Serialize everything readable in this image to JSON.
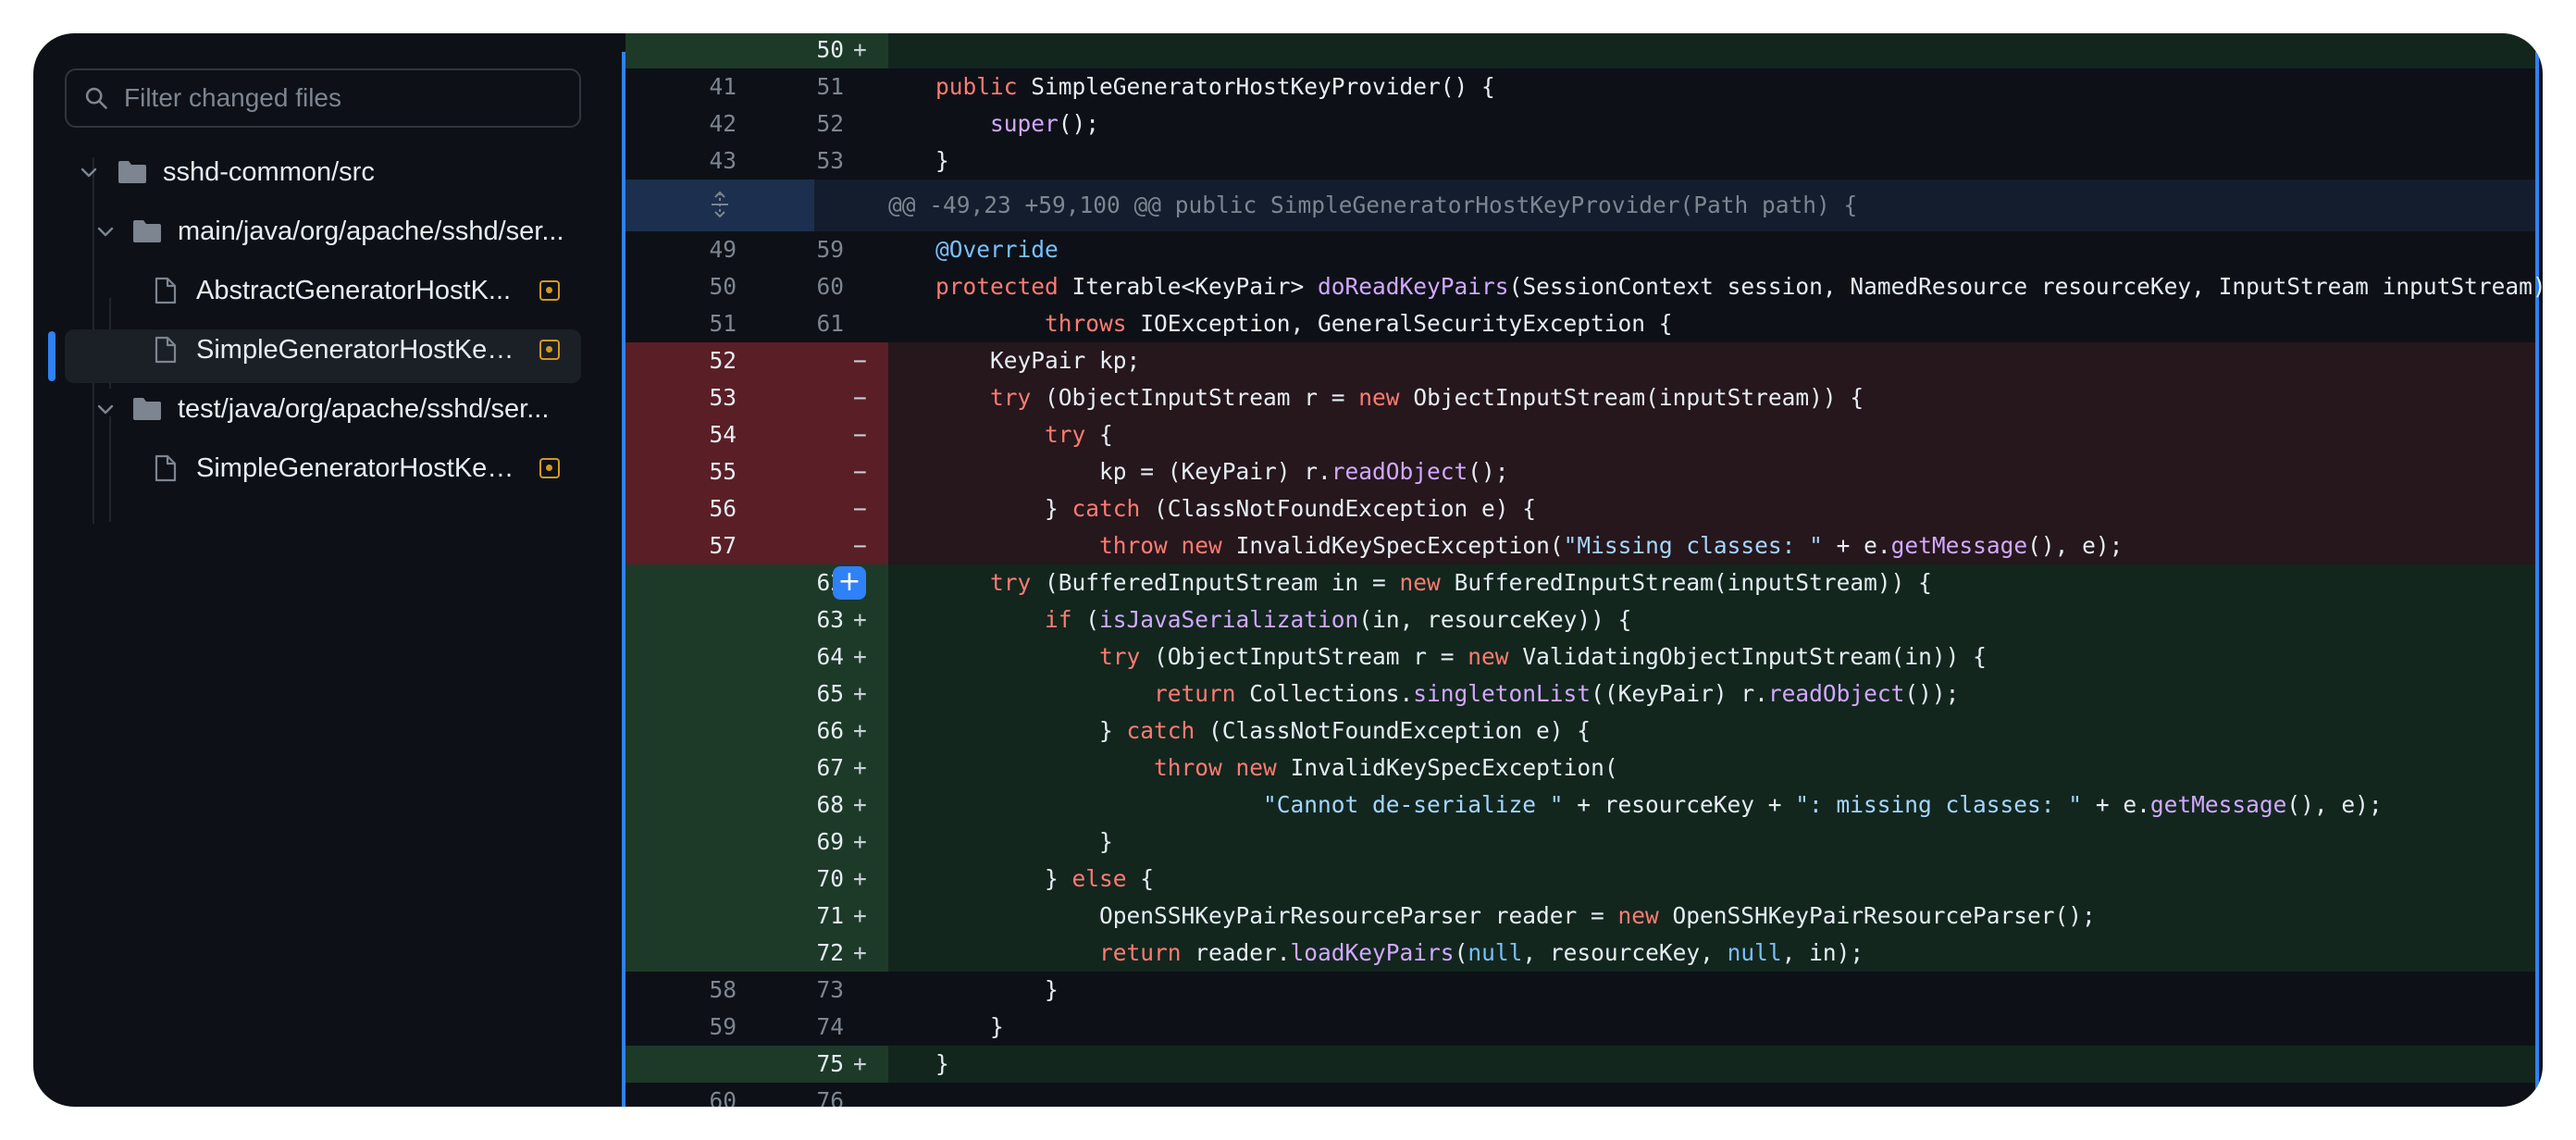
{
  "sidebar": {
    "search": {
      "placeholder": "Filter changed files"
    },
    "tree": [
      {
        "label": "sshd-common/src",
        "type": "folder"
      },
      {
        "label": "main/java/org/apache/sshd/ser...",
        "type": "folder"
      },
      {
        "label": "AbstractGeneratorHostK...",
        "type": "file",
        "status": "modified"
      },
      {
        "label": "SimpleGeneratorHostKey...",
        "type": "file",
        "status": "modified",
        "selected": true
      },
      {
        "label": "test/java/org/apache/sshd/ser...",
        "type": "folder"
      },
      {
        "label": "SimpleGeneratorHostKey...",
        "type": "file",
        "status": "modified"
      }
    ]
  },
  "diff": {
    "hunk_header": "@@ -49,23 +59,100 @@ public SimpleGeneratorHostKeyProvider(Path path) {",
    "lines": [
      {
        "type": "add",
        "old": "",
        "new": "50",
        "sign": "+",
        "code": []
      },
      {
        "type": "ctx",
        "old": "41",
        "new": "51",
        "sign": "",
        "code": [
          [
            "    ",
            ""
          ],
          [
            "public",
            "k"
          ],
          [
            " SimpleGeneratorHostKeyProvider() {",
            ""
          ]
        ]
      },
      {
        "type": "ctx",
        "old": "42",
        "new": "52",
        "sign": "",
        "code": [
          [
            "        ",
            ""
          ],
          [
            "super",
            "f"
          ],
          [
            "();",
            ""
          ]
        ]
      },
      {
        "type": "ctx",
        "old": "43",
        "new": "53",
        "sign": "",
        "code": [
          [
            "    }",
            ""
          ]
        ]
      },
      {
        "type": "hunk"
      },
      {
        "type": "ctx",
        "old": "49",
        "new": "59",
        "sign": "",
        "code": [
          [
            "    ",
            ""
          ],
          [
            "@Override",
            "c"
          ]
        ]
      },
      {
        "type": "ctx",
        "old": "50",
        "new": "60",
        "sign": "",
        "code": [
          [
            "    ",
            ""
          ],
          [
            "protected",
            "k"
          ],
          [
            " Iterable<KeyPair> ",
            ""
          ],
          [
            "doReadKeyPairs",
            "f"
          ],
          [
            "(SessionContext session, NamedResource resourceKey, InputStream inputStream)",
            ""
          ]
        ]
      },
      {
        "type": "ctx",
        "old": "51",
        "new": "61",
        "sign": "",
        "code": [
          [
            "            ",
            ""
          ],
          [
            "throws",
            "k"
          ],
          [
            " IOException, GeneralSecurityException {",
            ""
          ]
        ]
      },
      {
        "type": "del",
        "old": "52",
        "new": "",
        "sign": "−",
        "code": [
          [
            "        KeyPair kp;",
            ""
          ]
        ]
      },
      {
        "type": "del",
        "old": "53",
        "new": "",
        "sign": "−",
        "code": [
          [
            "        ",
            ""
          ],
          [
            "try",
            "k"
          ],
          [
            " (ObjectInputStream r = ",
            ""
          ],
          [
            "new",
            "k"
          ],
          [
            " ObjectInputStream(inputStream)) {",
            ""
          ]
        ]
      },
      {
        "type": "del",
        "old": "54",
        "new": "",
        "sign": "−",
        "code": [
          [
            "            ",
            ""
          ],
          [
            "try",
            "k"
          ],
          [
            " {",
            ""
          ]
        ]
      },
      {
        "type": "del",
        "old": "55",
        "new": "",
        "sign": "−",
        "code": [
          [
            "                kp = (KeyPair) r.",
            ""
          ],
          [
            "readObject",
            "f"
          ],
          [
            "();",
            ""
          ]
        ]
      },
      {
        "type": "del",
        "old": "56",
        "new": "",
        "sign": "−",
        "code": [
          [
            "            } ",
            ""
          ],
          [
            "catch",
            "k"
          ],
          [
            " (ClassNotFoundException e) {",
            ""
          ]
        ]
      },
      {
        "type": "del",
        "old": "57",
        "new": "",
        "sign": "−",
        "code": [
          [
            "                ",
            ""
          ],
          [
            "throw",
            "k"
          ],
          [
            " ",
            ""
          ],
          [
            "new",
            "k"
          ],
          [
            " InvalidKeySpecException(",
            ""
          ],
          [
            "\"Missing classes: \"",
            "s"
          ],
          [
            " + e.",
            ""
          ],
          [
            "getMessage",
            "f"
          ],
          [
            "(), e);",
            ""
          ]
        ]
      },
      {
        "type": "add",
        "old": "",
        "new": "62",
        "sign": "+",
        "plus_button": true,
        "code": [
          [
            "        ",
            ""
          ],
          [
            "try",
            "k"
          ],
          [
            " (BufferedInputStream in = ",
            ""
          ],
          [
            "new",
            "k"
          ],
          [
            " BufferedInputStream(inputStream)) {",
            ""
          ]
        ]
      },
      {
        "type": "add",
        "old": "",
        "new": "63",
        "sign": "+",
        "code": [
          [
            "            ",
            ""
          ],
          [
            "if",
            "k"
          ],
          [
            " (",
            ""
          ],
          [
            "isJavaSerialization",
            "f"
          ],
          [
            "(in, resourceKey)) {",
            ""
          ]
        ]
      },
      {
        "type": "add",
        "old": "",
        "new": "64",
        "sign": "+",
        "code": [
          [
            "                ",
            ""
          ],
          [
            "try",
            "k"
          ],
          [
            " (ObjectInputStream r = ",
            ""
          ],
          [
            "new",
            "k"
          ],
          [
            " ValidatingObjectInputStream(in)) {",
            ""
          ]
        ]
      },
      {
        "type": "add",
        "old": "",
        "new": "65",
        "sign": "+",
        "code": [
          [
            "                    ",
            ""
          ],
          [
            "return",
            "k"
          ],
          [
            " Collections.",
            ""
          ],
          [
            "singletonList",
            "f"
          ],
          [
            "((KeyPair) r.",
            ""
          ],
          [
            "readObject",
            "f"
          ],
          [
            "());",
            ""
          ]
        ]
      },
      {
        "type": "add",
        "old": "",
        "new": "66",
        "sign": "+",
        "code": [
          [
            "                } ",
            ""
          ],
          [
            "catch",
            "k"
          ],
          [
            " (ClassNotFoundException e) {",
            ""
          ]
        ]
      },
      {
        "type": "add",
        "old": "",
        "new": "67",
        "sign": "+",
        "code": [
          [
            "                    ",
            ""
          ],
          [
            "throw",
            "k"
          ],
          [
            " ",
            ""
          ],
          [
            "new",
            "k"
          ],
          [
            " InvalidKeySpecException(",
            ""
          ]
        ]
      },
      {
        "type": "add",
        "old": "",
        "new": "68",
        "sign": "+",
        "code": [
          [
            "                            ",
            ""
          ],
          [
            "\"Cannot de-serialize \"",
            "s"
          ],
          [
            " + resourceKey + ",
            ""
          ],
          [
            "\": missing classes: \"",
            "s"
          ],
          [
            " + e.",
            ""
          ],
          [
            "getMessage",
            "f"
          ],
          [
            "(), e);",
            ""
          ]
        ]
      },
      {
        "type": "add",
        "old": "",
        "new": "69",
        "sign": "+",
        "code": [
          [
            "                }",
            ""
          ]
        ]
      },
      {
        "type": "add",
        "old": "",
        "new": "70",
        "sign": "+",
        "code": [
          [
            "            } ",
            ""
          ],
          [
            "else",
            "k"
          ],
          [
            " {",
            ""
          ]
        ]
      },
      {
        "type": "add",
        "old": "",
        "new": "71",
        "sign": "+",
        "code": [
          [
            "                OpenSSHKeyPairResourceParser reader = ",
            ""
          ],
          [
            "new",
            "k"
          ],
          [
            " OpenSSHKeyPairResourceParser();",
            ""
          ]
        ]
      },
      {
        "type": "add",
        "old": "",
        "new": "72",
        "sign": "+",
        "code": [
          [
            "                ",
            ""
          ],
          [
            "return",
            "k"
          ],
          [
            " reader.",
            ""
          ],
          [
            "loadKeyPairs",
            "f"
          ],
          [
            "(",
            ""
          ],
          [
            "null",
            "c"
          ],
          [
            ", resourceKey, ",
            ""
          ],
          [
            "null",
            "c"
          ],
          [
            ", in);",
            ""
          ]
        ]
      },
      {
        "type": "ctx",
        "old": "58",
        "new": "73",
        "sign": "",
        "code": [
          [
            "            }",
            ""
          ]
        ]
      },
      {
        "type": "ctx",
        "old": "59",
        "new": "74",
        "sign": "",
        "code": [
          [
            "        }",
            ""
          ]
        ]
      },
      {
        "type": "add",
        "old": "",
        "new": "75",
        "sign": "+",
        "code": [
          [
            "    }",
            ""
          ]
        ]
      },
      {
        "type": "ctx",
        "old": "60",
        "new": "76",
        "sign": "",
        "code": []
      }
    ]
  },
  "colors": {
    "accent": "#2f81f7",
    "modified_badge": "#d29922",
    "added_bg": "#12261e",
    "deleted_bg": "#25171c",
    "hunk_bg": "#131d2e"
  }
}
